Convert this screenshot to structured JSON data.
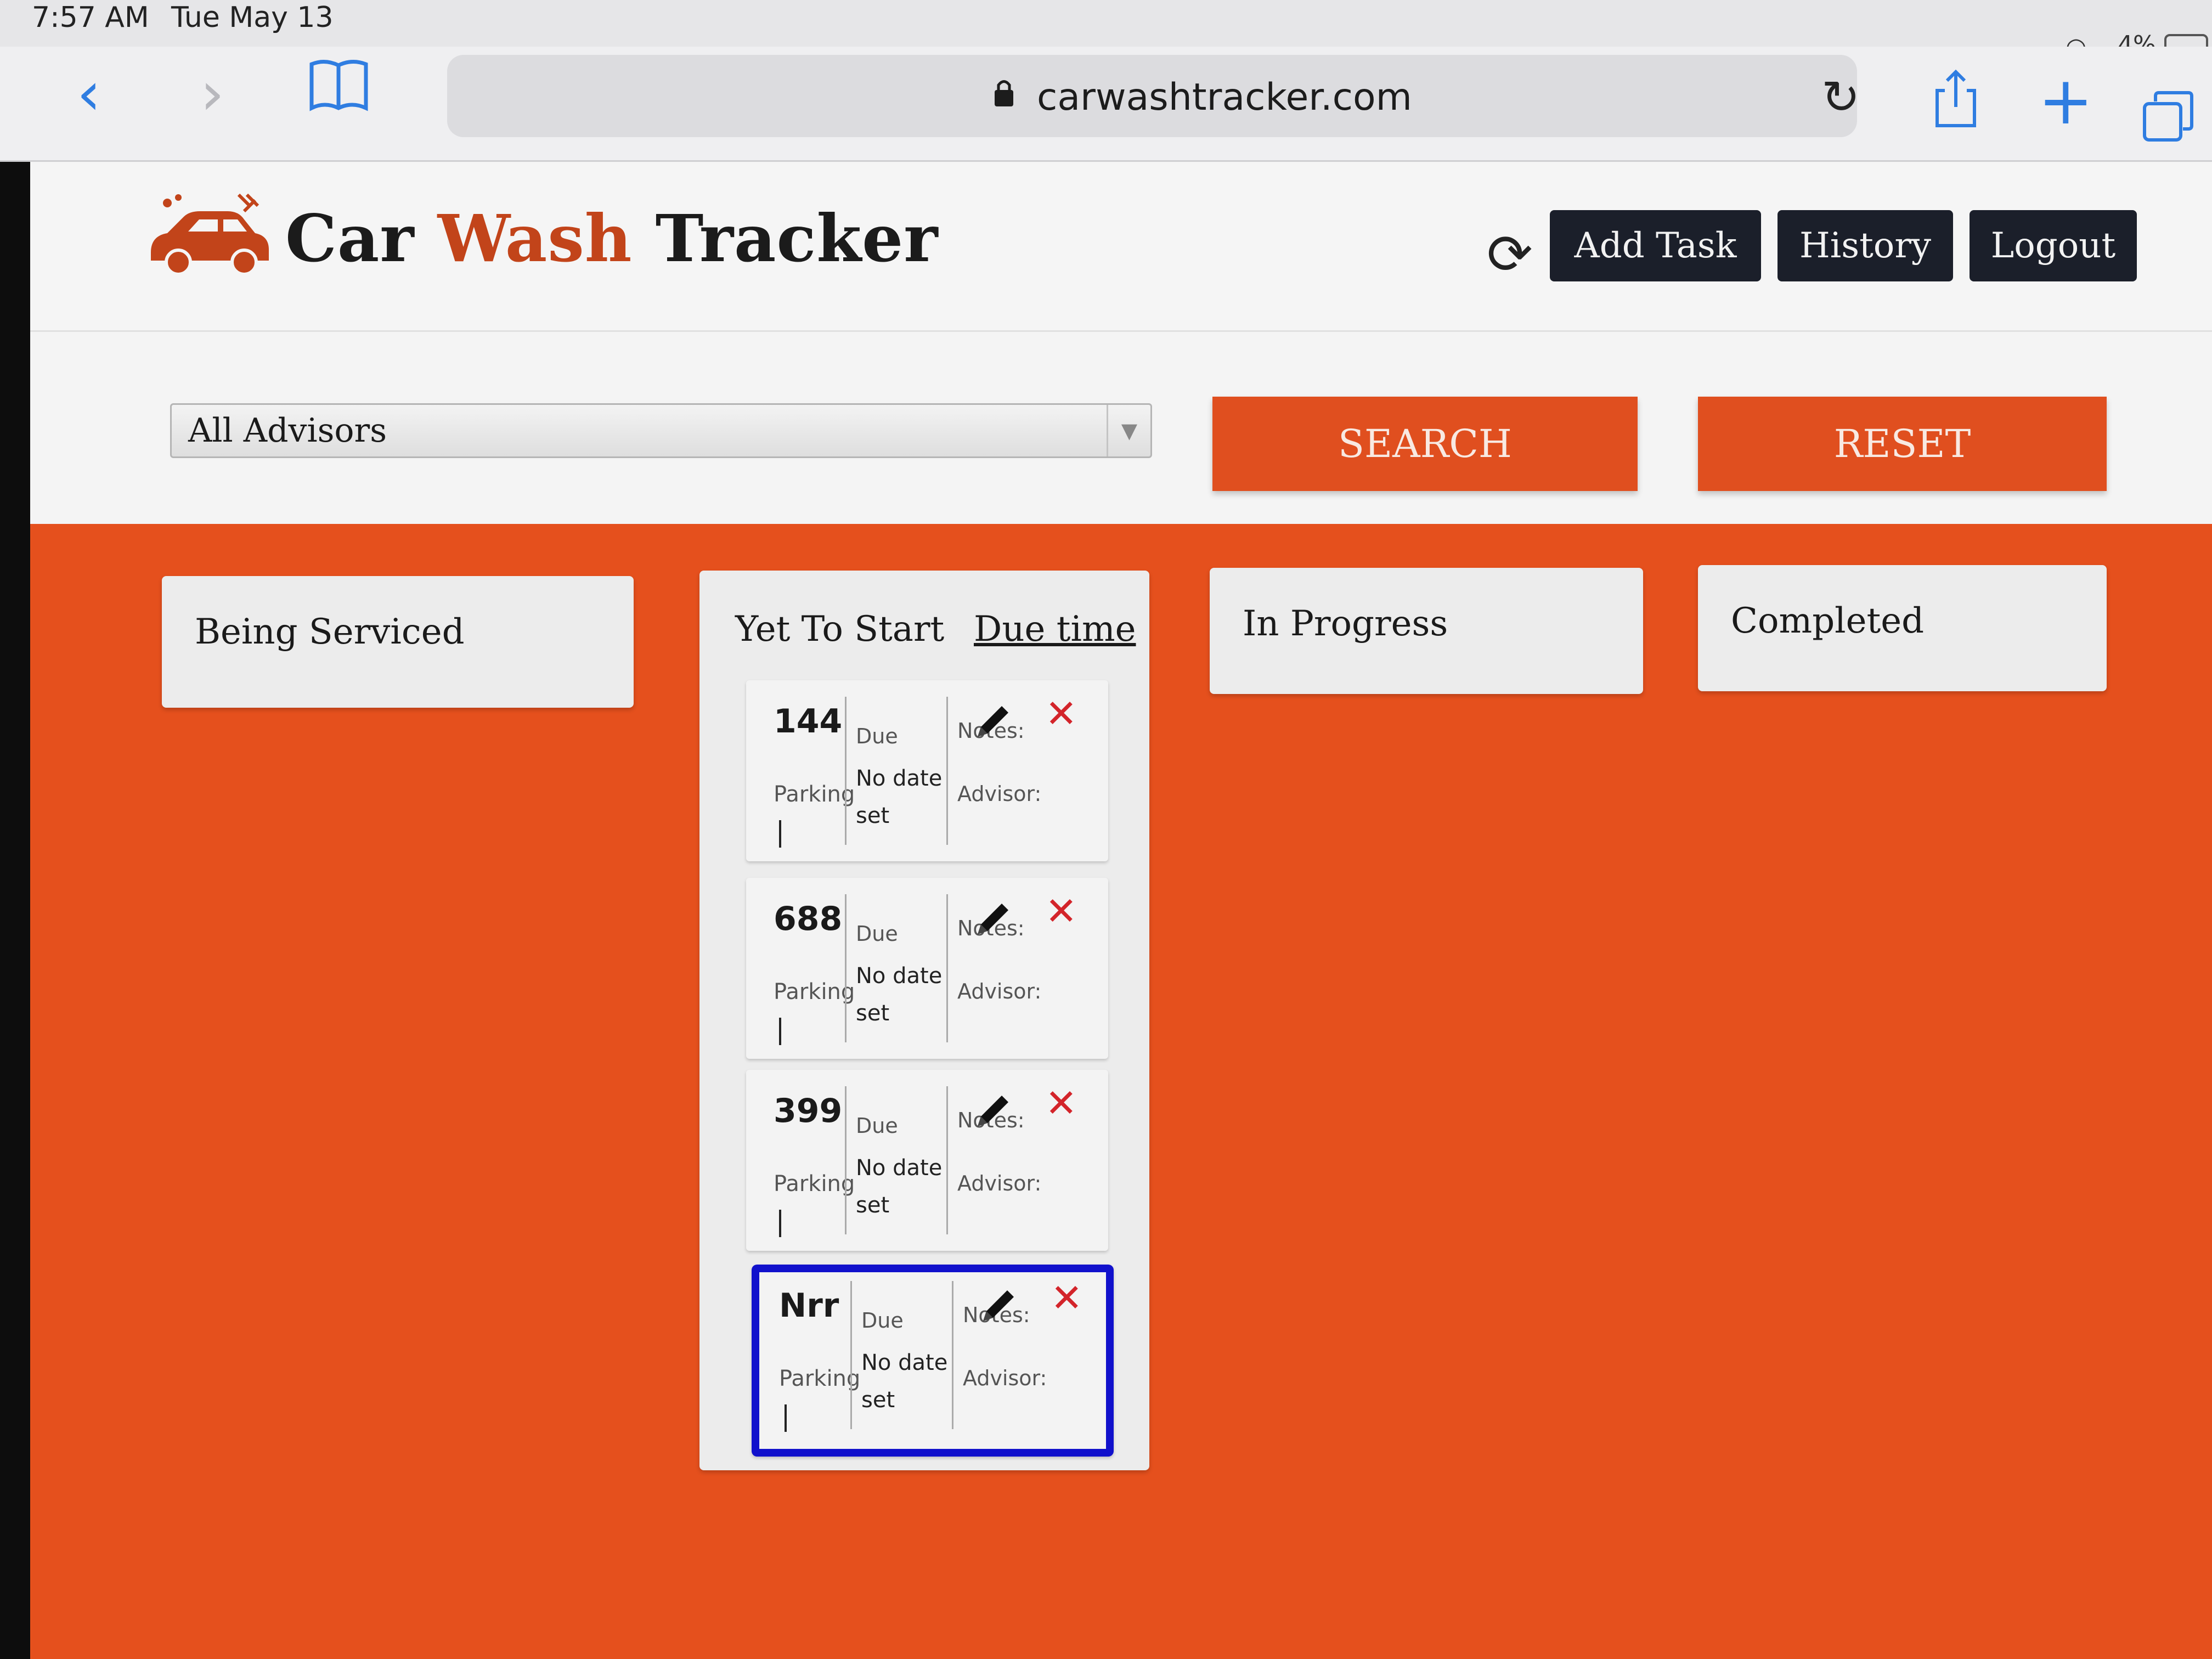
{
  "status": {
    "time": "7:57 AM",
    "date": "Tue May 13",
    "battery": "4%"
  },
  "browser": {
    "url": "carwashtracker.com"
  },
  "header": {
    "brand_part1": "Car ",
    "brand_part2": "Wash",
    "brand_part3": " Tracker",
    "add_task": "Add Task",
    "history": "History",
    "logout": "Logout"
  },
  "filter": {
    "advisor_selected": "All Advisors",
    "search": "SEARCH",
    "reset": "RESET"
  },
  "columns": {
    "being_serviced": "Being Serviced",
    "yet_to_start": "Yet To Start",
    "sort_label": "Due time",
    "in_progress": "In Progress",
    "completed": "Completed"
  },
  "cards": [
    {
      "number": "144",
      "parking": "Parking",
      "due": "Due",
      "due_value": "No date set",
      "notes": "Notes:",
      "advisor": "Advisor:"
    },
    {
      "number": "688",
      "parking": "Parking",
      "due": "Due",
      "due_value": "No date set",
      "notes": "Notes:",
      "advisor": "Advisor:"
    },
    {
      "number": "399",
      "parking": "Parking",
      "due": "Due",
      "due_value": "No date set",
      "notes": "Notes:",
      "advisor": "Advisor:"
    },
    {
      "number": "Nrr",
      "parking": "Parking",
      "due": "Due",
      "due_value": "No date set",
      "notes": "Notes:",
      "advisor": "Advisor:"
    }
  ],
  "colors": {
    "brand_orange": "#e5501d",
    "accent_text": "#c2441a",
    "dark_button": "#1b1f2a",
    "delete_red": "#d3242a",
    "selected_border": "#1111cc"
  }
}
